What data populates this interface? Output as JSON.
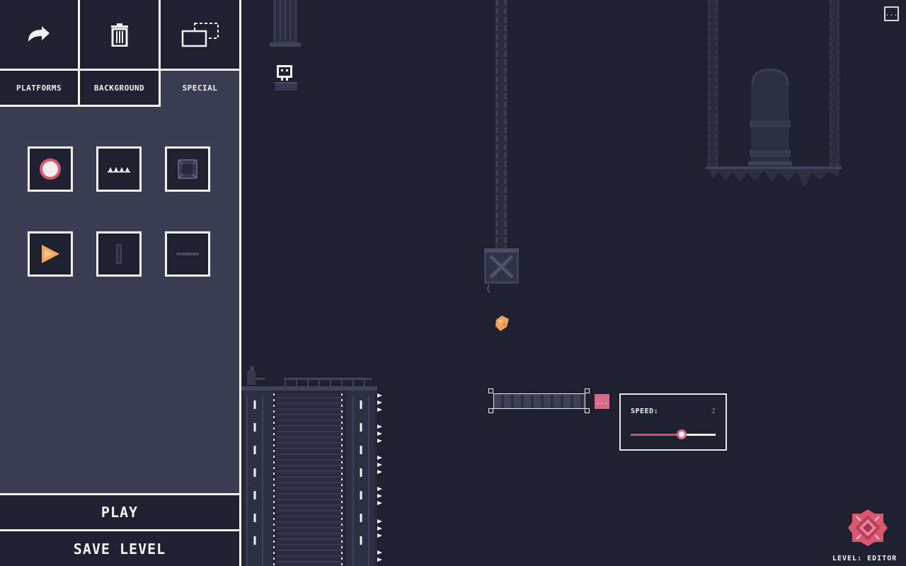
{
  "toolbar": {
    "redo_icon": "redo-arrow-icon",
    "delete_icon": "trash-icon",
    "select_icon": "multi-select-icon"
  },
  "tabs": [
    {
      "label": "PLATFORMS",
      "active": false
    },
    {
      "label": "BACKGROUND",
      "active": false
    },
    {
      "label": "SPECIAL",
      "active": true
    }
  ],
  "special_items": [
    {
      "icon": "pink-orb-icon"
    },
    {
      "icon": "spike-row-icon"
    },
    {
      "icon": "dark-block-icon"
    },
    {
      "icon": "orange-triangle-icon"
    },
    {
      "icon": "narrow-pillar-icon"
    },
    {
      "icon": "thin-platform-icon"
    }
  ],
  "actions": {
    "play_label": "PLAY",
    "save_label": "SAVE LEVEL"
  },
  "canvas": {
    "menu_label": "...",
    "option_label": "...",
    "speed_panel": {
      "label": "SPEED:",
      "value": "2",
      "fraction": 0.6
    },
    "level_label": "LEVEL: EDITOR"
  },
  "colors": {
    "background": "#1f2130",
    "panel": "#3a3e55",
    "accent_pink": "#d96a86",
    "white": "#f2f2f2"
  }
}
